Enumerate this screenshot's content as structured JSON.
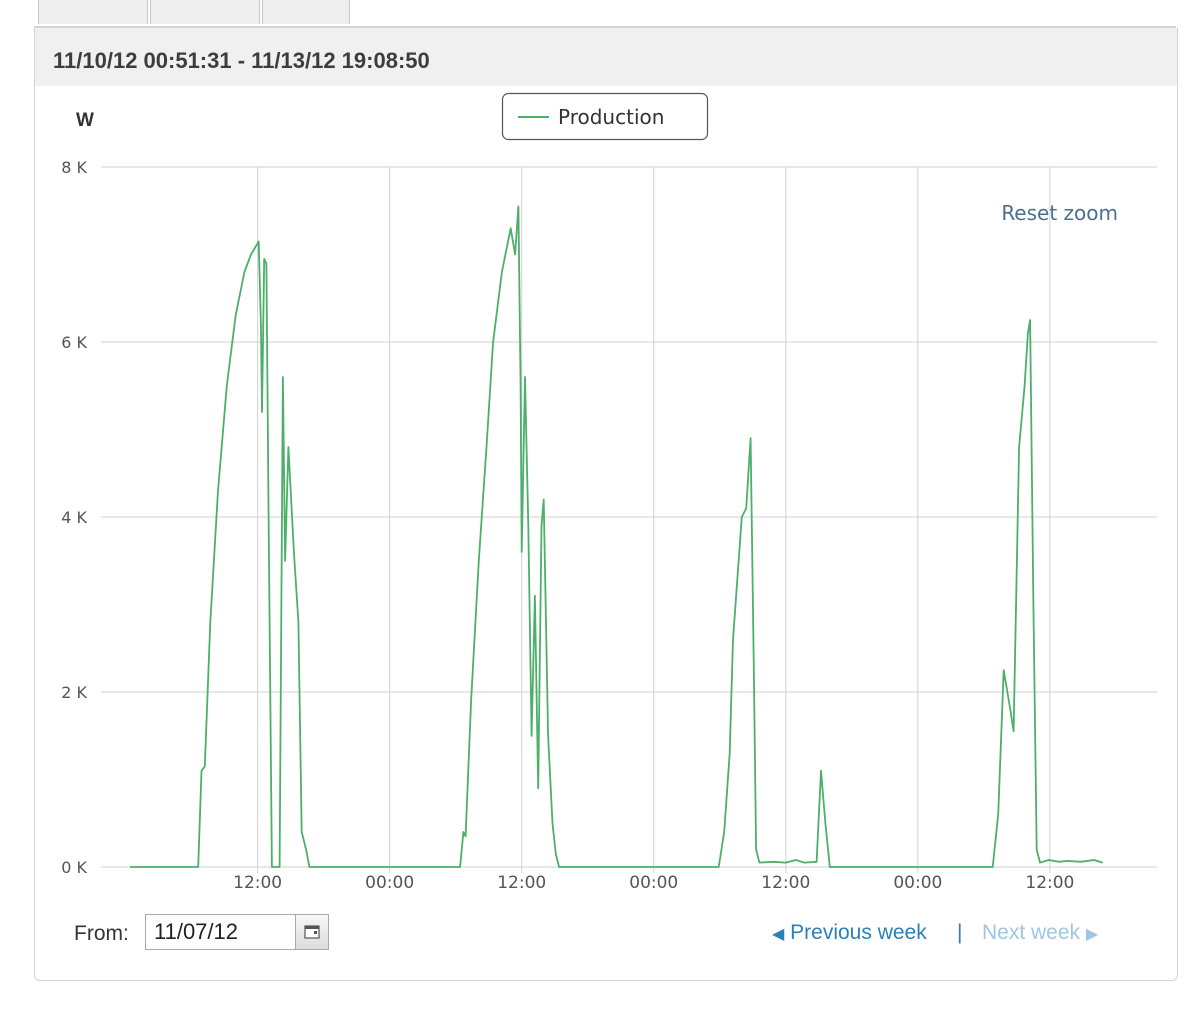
{
  "header": {
    "title": "11/10/12 00:51:31 - 11/13/12 19:08:50"
  },
  "controls": {
    "from_label": "From:",
    "from_value": "11/07/12",
    "prev_label": "Previous week",
    "separator": "|",
    "next_label": "Next week",
    "reset_zoom": "Reset zoom"
  },
  "colors": {
    "series": "#4caf6a",
    "grid": "#d0d0d0",
    "axis_text": "#555555",
    "link": "#2d7fb8",
    "link_disabled": "#9ec6e2",
    "reset_zoom": "#4a7090"
  },
  "icons": [
    "calendar-icon",
    "triangle-left-icon",
    "triangle-right-icon"
  ],
  "chart_data": {
    "type": "line",
    "title": "",
    "xlabel": "",
    "ylabel": "W",
    "x_unit": "hours",
    "ylim": [
      0,
      8000
    ],
    "xlim": [
      0,
      90.7
    ],
    "y_ticks": [
      {
        "value": 0,
        "label": "0 K"
      },
      {
        "value": 2000,
        "label": "2 K"
      },
      {
        "value": 4000,
        "label": "4 K"
      },
      {
        "value": 6000,
        "label": "6 K"
      },
      {
        "value": 8000,
        "label": "8 K"
      }
    ],
    "x_ticks": [
      {
        "value": 11.6,
        "label": "12:00"
      },
      {
        "value": 23.6,
        "label": "00:00"
      },
      {
        "value": 35.6,
        "label": "12:00"
      },
      {
        "value": 47.6,
        "label": "00:00"
      },
      {
        "value": 59.6,
        "label": "12:00"
      },
      {
        "value": 71.6,
        "label": "00:00"
      },
      {
        "value": 83.6,
        "label": "12:00"
      }
    ],
    "grid": true,
    "legend_position": "top-center",
    "series": [
      {
        "name": "Production",
        "points": [
          [
            0,
            0
          ],
          [
            6.2,
            0
          ],
          [
            6.5,
            1100
          ],
          [
            6.8,
            1150
          ],
          [
            7.3,
            2800
          ],
          [
            8.0,
            4300
          ],
          [
            8.8,
            5500
          ],
          [
            9.6,
            6300
          ],
          [
            10.4,
            6800
          ],
          [
            11.0,
            7000
          ],
          [
            11.7,
            7150
          ],
          [
            11.9,
            6200
          ],
          [
            12.0,
            5200
          ],
          [
            12.2,
            6950
          ],
          [
            12.4,
            6900
          ],
          [
            12.6,
            4000
          ],
          [
            12.9,
            0
          ],
          [
            13.6,
            0
          ],
          [
            13.9,
            5600
          ],
          [
            14.1,
            3500
          ],
          [
            14.4,
            4800
          ],
          [
            14.9,
            3600
          ],
          [
            15.3,
            2800
          ],
          [
            15.6,
            400
          ],
          [
            16.0,
            200
          ],
          [
            16.3,
            0
          ],
          [
            30.0,
            0
          ],
          [
            30.3,
            400
          ],
          [
            30.5,
            350
          ],
          [
            31.0,
            1900
          ],
          [
            31.7,
            3500
          ],
          [
            32.4,
            4800
          ],
          [
            33.0,
            6000
          ],
          [
            33.8,
            6800
          ],
          [
            34.6,
            7300
          ],
          [
            35.0,
            7000
          ],
          [
            35.3,
            7550
          ],
          [
            35.5,
            5500
          ],
          [
            35.6,
            3600
          ],
          [
            35.9,
            5600
          ],
          [
            36.2,
            3900
          ],
          [
            36.5,
            1500
          ],
          [
            36.8,
            3100
          ],
          [
            37.1,
            900
          ],
          [
            37.4,
            3900
          ],
          [
            37.6,
            4200
          ],
          [
            38.0,
            1500
          ],
          [
            38.4,
            500
          ],
          [
            38.7,
            150
          ],
          [
            39.0,
            0
          ],
          [
            53.5,
            0
          ],
          [
            54.0,
            400
          ],
          [
            54.5,
            1300
          ],
          [
            54.8,
            2600
          ],
          [
            55.2,
            3300
          ],
          [
            55.6,
            4000
          ],
          [
            56.0,
            4100
          ],
          [
            56.4,
            4900
          ],
          [
            56.7,
            2200
          ],
          [
            56.9,
            200
          ],
          [
            57.2,
            50
          ],
          [
            58.5,
            60
          ],
          [
            59.6,
            50
          ],
          [
            60.5,
            80
          ],
          [
            61.3,
            50
          ],
          [
            62.4,
            60
          ],
          [
            62.8,
            1100
          ],
          [
            63.2,
            500
          ],
          [
            63.6,
            0
          ],
          [
            78.4,
            0
          ],
          [
            78.9,
            600
          ],
          [
            79.4,
            2250
          ],
          [
            80.0,
            1800
          ],
          [
            80.3,
            1550
          ],
          [
            80.8,
            4800
          ],
          [
            81.3,
            5500
          ],
          [
            81.6,
            6100
          ],
          [
            81.8,
            6250
          ],
          [
            82.1,
            3000
          ],
          [
            82.4,
            200
          ],
          [
            82.7,
            50
          ],
          [
            83.5,
            80
          ],
          [
            84.4,
            60
          ],
          [
            85.2,
            70
          ],
          [
            86.4,
            60
          ],
          [
            87.6,
            80
          ],
          [
            88.4,
            50
          ]
        ]
      }
    ]
  }
}
